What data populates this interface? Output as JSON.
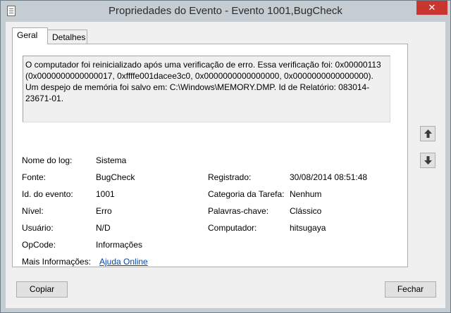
{
  "window": {
    "title": "Propriedades do Evento - Evento 1001,BugCheck",
    "close_glyph": "✕"
  },
  "tabs": [
    {
      "label": "Geral",
      "active": true
    },
    {
      "label": "Detalhes",
      "active": false
    }
  ],
  "description": "O computador foi reinicializado após uma verificação de erro. Essa verificação foi: 0x00000113 (0x0000000000000017, 0xffffe001dacee3c0, 0x0000000000000000, 0x0000000000000000). Um despejo de memória foi salvo em: C:\\Windows\\MEMORY.DMP. Id de Relatório: 083014-23671-01.",
  "fields": {
    "log_name": {
      "label": "Nome do log:",
      "value": "Sistema"
    },
    "source": {
      "label": "Fonte:",
      "value": "BugCheck"
    },
    "logged": {
      "label": "Registrado:",
      "value": "30/08/2014 08:51:48"
    },
    "event_id": {
      "label": "Id. do evento:",
      "value": "1001"
    },
    "task_category": {
      "label": "Categoria da Tarefa:",
      "value": "Nenhum"
    },
    "level": {
      "label": "Nível:",
      "value": "Erro"
    },
    "keywords": {
      "label": "Palavras-chave:",
      "value": "Clássico"
    },
    "user": {
      "label": "Usuário:",
      "value": "N/D"
    },
    "computer": {
      "label": "Computador:",
      "value": "hitsugaya"
    },
    "opcode": {
      "label": "OpCode:",
      "value": "Informações"
    },
    "more_info": {
      "label": "Mais Informações:",
      "value": "Ajuda Online"
    }
  },
  "buttons": {
    "copy": "Copiar",
    "close": "Fechar"
  },
  "icons": {
    "up": "arrow-up-icon",
    "down": "arrow-down-icon"
  },
  "colors": {
    "titlebar": "#c6cdd2",
    "close_button": "#c7372f",
    "link": "#0645ad"
  }
}
